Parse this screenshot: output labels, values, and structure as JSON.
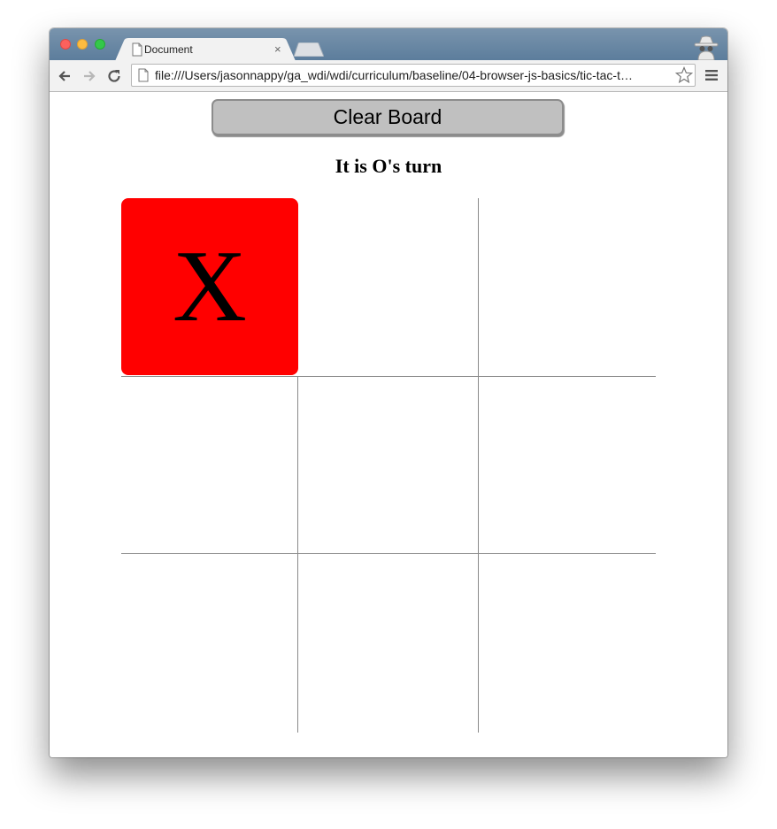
{
  "browser": {
    "tab_title": "Document",
    "tab_close": "×",
    "url": "file:///Users/jasonnappy/ga_wdi/wdi/curriculum/baseline/04-browser-js-basics/tic-tac-t…"
  },
  "page": {
    "clear_button": "Clear Board",
    "turn_text": "It is O's turn",
    "board": [
      "X",
      "",
      "",
      "",
      "",
      "",
      "",
      "",
      ""
    ]
  },
  "colors": {
    "x_cell": "#ff0000",
    "button_bg": "#c0c0c0",
    "titlebar": "#5c7d9c"
  }
}
